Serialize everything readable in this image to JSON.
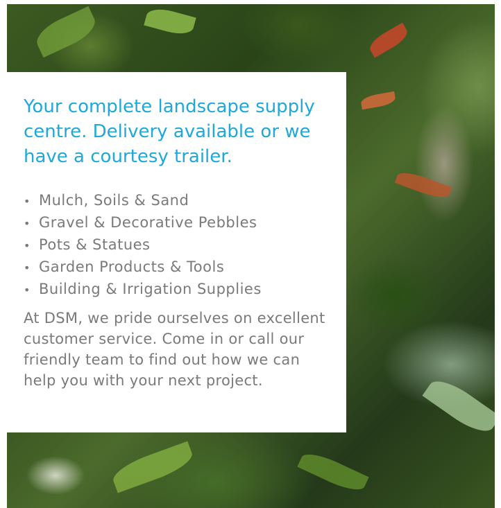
{
  "headline": "Your complete landscape supply centre. Delivery available or we have a courtesy trailer.",
  "products": [
    "Mulch, Soils & Sand",
    "Gravel & Decorative Pebbles",
    "Pots & Statues",
    "Garden Products & Tools",
    "Building & Irrigation Supplies"
  ],
  "bullet_symbol": "•",
  "body_text": "At DSM, we pride ourselves on excellent customer service. Come in or call our friendly team to find out how we can help you with your next project.",
  "colors": {
    "headline": "#1fa8d9",
    "body": "#7a7a7a",
    "panel": "#ffffff"
  }
}
